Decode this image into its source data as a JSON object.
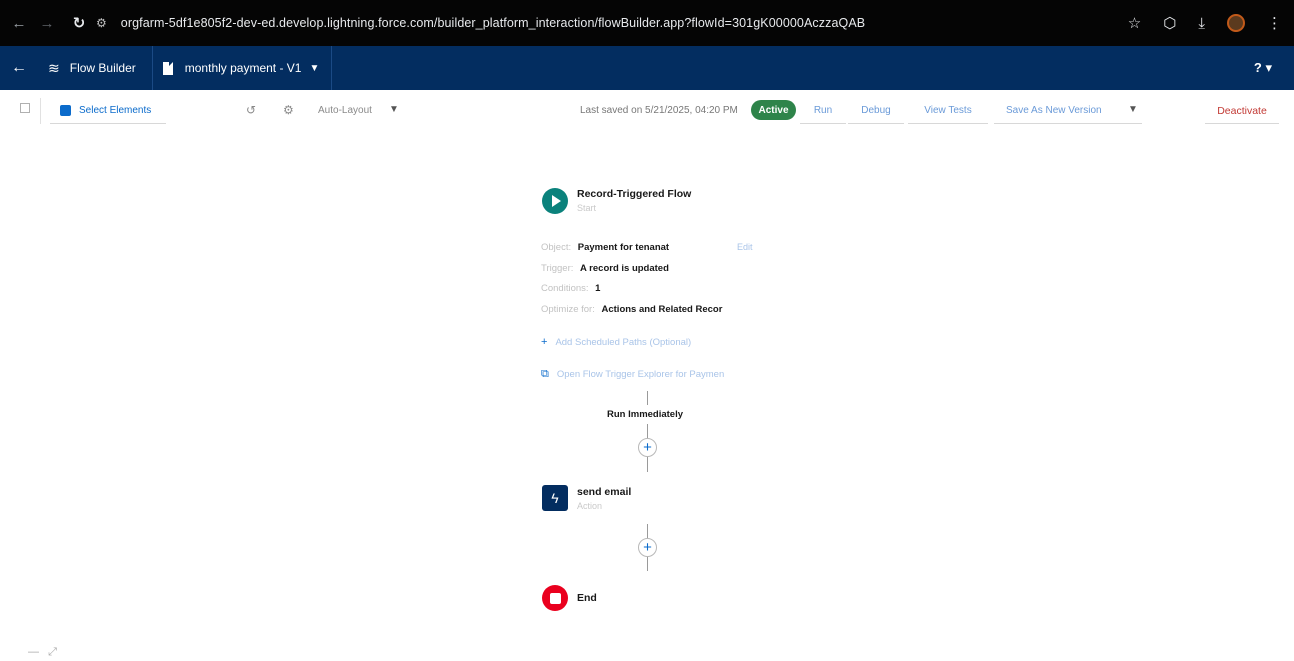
{
  "browser": {
    "url": "orgfarm-5df1e805f2-dev-ed.develop.lightning.force.com/builder_platform_interaction/flowBuilder.app?flowId=301gK00000AczzaQAB"
  },
  "header": {
    "app_name": "Flow Builder",
    "flow_name": "monthly payment - V1",
    "help_label": "?"
  },
  "toolbar": {
    "select_elements": "Select Elements",
    "layout": "Auto-Layout",
    "last_saved": "Last saved on 5/21/2025, 04:20 PM",
    "status": "Active",
    "run": "Run",
    "debug": "Debug",
    "view_tests": "View Tests",
    "save_as": "Save As New Version",
    "deactivate": "Deactivate"
  },
  "start_node": {
    "title": "Record-Triggered Flow",
    "subtitle": "Start",
    "object_label": "Object:",
    "object_value": "Payment for tenanat",
    "edit": "Edit",
    "trigger_label": "Trigger:",
    "trigger_value": "A record is updated",
    "conditions_label": "Conditions:",
    "conditions_value": "1",
    "optimize_label": "Optimize for:",
    "optimize_value": "Actions and Related Recor",
    "add_path": "Add Scheduled Paths (Optional)",
    "open_explorer": "Open Flow Trigger Explorer for Paymen"
  },
  "path_label": "Run Immediately",
  "action_node": {
    "title": "send email",
    "subtitle": "Action"
  },
  "end_node": {
    "title": "End"
  },
  "colors": {
    "header_bg": "#032d60",
    "active_badge": "#2e844a",
    "start_icon": "#0b827c",
    "end_icon": "#ea001e",
    "link": "#0b6bcb"
  }
}
